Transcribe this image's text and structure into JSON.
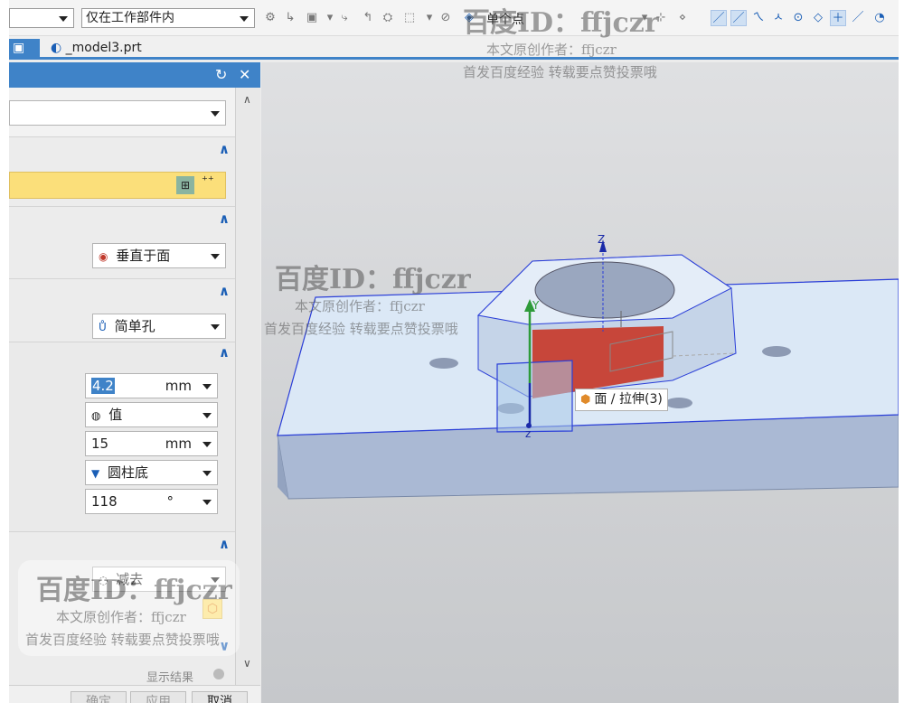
{
  "toolbar": {
    "filter_select": "",
    "scope_select": "仅在工作部件内",
    "snap_select": "单个点"
  },
  "tabs": {
    "active_tab": "",
    "file_tab": "_model3.prt"
  },
  "dialog": {
    "top_dropdown": "",
    "direction_dropdown": "垂直于面",
    "hole_form_dropdown": "简单孔",
    "diameter_value": "4.2",
    "diameter_unit": "mm",
    "depth_limit_dropdown": "值",
    "depth_value": "15",
    "depth_unit": "mm",
    "tip_dropdown": "圆柱底",
    "tip_angle_value": "118",
    "tip_angle_unit": "°",
    "boolean_dropdown": "减去",
    "show_result_label": "显示结果",
    "ok_button": "确定",
    "apply_button": "应用",
    "cancel_button": "取消"
  },
  "viewport": {
    "face_label": "面 / 拉伸(3)",
    "axis_z": "Z",
    "axis_y": "Y",
    "axis_z_lower": "z"
  },
  "watermarks": [
    {
      "id": "百度ID：ffjczr",
      "line1": "本文原创作者：ffjczr",
      "line2": "首发百度经验 转载要点赞投票哦"
    },
    {
      "id": "百度ID：ffjczr",
      "line1": "本文原创作者：ffjczr",
      "line2": "首发百度经验 转载要点赞投票哦"
    },
    {
      "id": "百度ID：ffjczr",
      "line1": "本文原创作者：ffjczr",
      "line2": "首发百度经验 转载要点赞投票哦"
    }
  ],
  "colors": {
    "accent": "#3f83c8",
    "highlight_face": "#c7463a",
    "model": "#dbe8f6",
    "edge": "#2a3ed8"
  }
}
